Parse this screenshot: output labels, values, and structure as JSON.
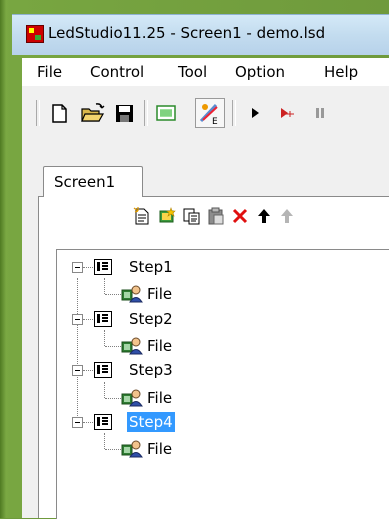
{
  "window": {
    "title": "LedStudio11.25 - Screen1 - demo.lsd"
  },
  "menu": {
    "items": [
      "File",
      "Control",
      "Tool",
      "Option",
      "Help"
    ]
  },
  "toolbar": {
    "icons": [
      "new-file-icon",
      "open-folder-icon",
      "save-icon",
      "screen-icon",
      "edit-program-icon",
      "play-icon",
      "play-step-icon",
      "pause-icon"
    ]
  },
  "tabs": [
    {
      "label": "Screen1",
      "active": true
    }
  ],
  "item_actions": [
    "new-item-icon",
    "new-star-icon",
    "copy-icon",
    "paste-icon",
    "delete-icon",
    "move-up-icon",
    "move-down-icon"
  ],
  "tree": {
    "steps": [
      {
        "label": "Step1",
        "child": "File",
        "selected": false
      },
      {
        "label": "Step2",
        "child": "File",
        "selected": false
      },
      {
        "label": "Step3",
        "child": "File",
        "selected": false
      },
      {
        "label": "Step4",
        "child": "File",
        "selected": true
      }
    ]
  },
  "colors": {
    "selection": "#3399ff",
    "title_bar": "#c3dcef",
    "frame": "#6f9a3c"
  }
}
